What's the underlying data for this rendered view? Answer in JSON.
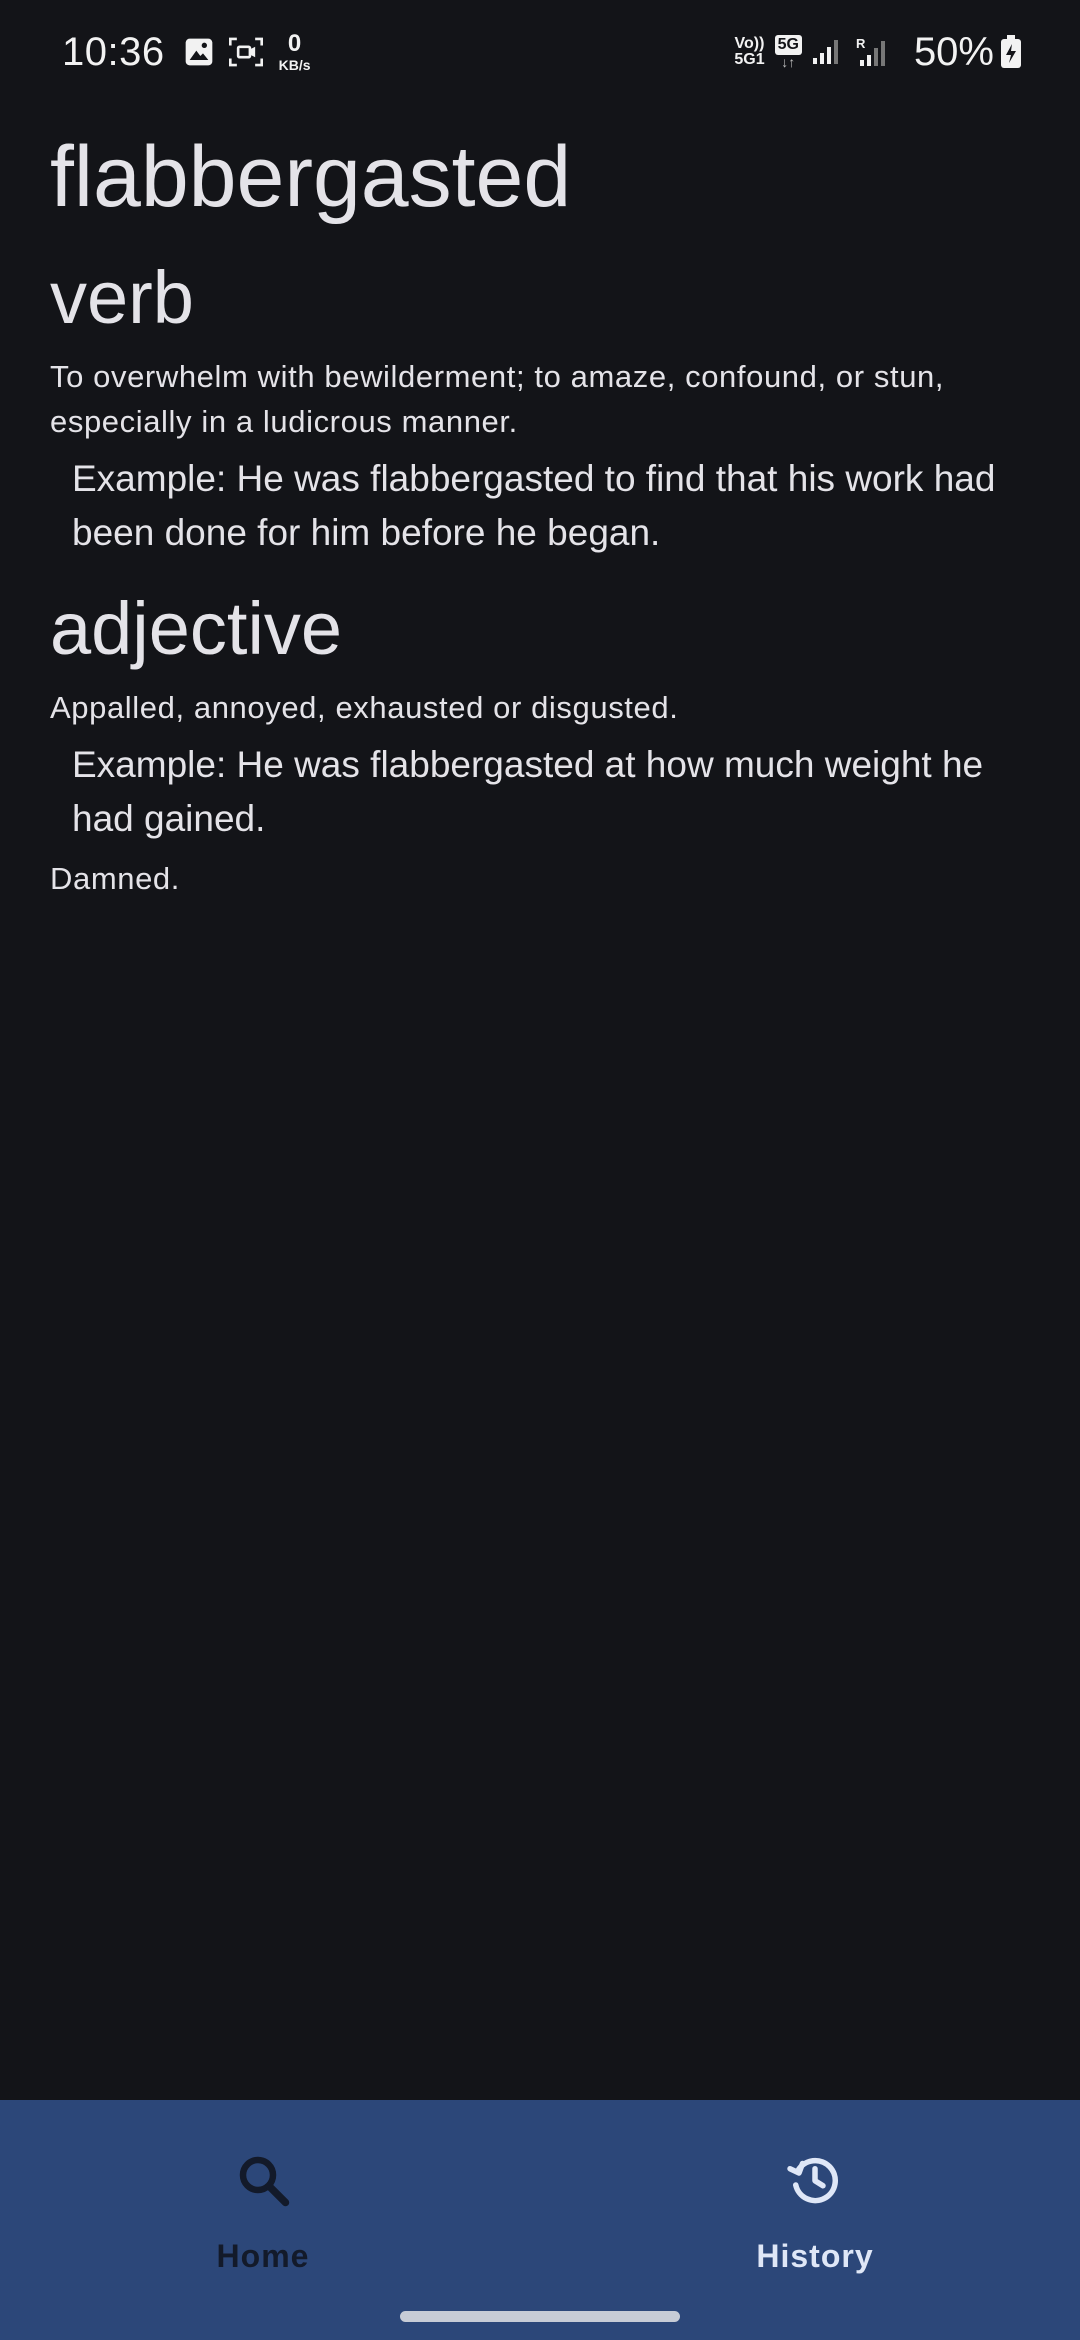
{
  "status_bar": {
    "time": "10:36",
    "net_speed_value": "0",
    "net_speed_unit": "KB/s",
    "volte_top": "Vo))",
    "volte_bottom": "5G1",
    "network_type": "5G",
    "network_arrows": "↓↑",
    "roaming": "R",
    "battery_percent": "50%",
    "icons": [
      "gallery-icon",
      "screen-record-icon",
      "signal-icon",
      "signal-roaming-icon",
      "battery-charging-icon"
    ]
  },
  "entry": {
    "word": "flabbergasted",
    "senses": [
      {
        "part_of_speech": "verb",
        "definition": "To overwhelm with bewilderment; to amaze, confound, or stun, especially in a ludicrous manner.",
        "example": "Example: He was flabbergasted to find that his work had been done for him before he began."
      },
      {
        "part_of_speech": "adjective",
        "definition": "Appalled, annoyed, exhausted or disgusted.",
        "example": "Example: He was flabbergasted at how much weight he had gained.",
        "definition_2": "Damned."
      }
    ]
  },
  "bottom_nav": {
    "items": [
      {
        "label": "Home",
        "icon": "search-icon",
        "selected": false
      },
      {
        "label": "History",
        "icon": "history-icon",
        "selected": true
      }
    ],
    "background_color": "#2c4779"
  },
  "colors": {
    "background": "#131418",
    "text": "#e4e3e8"
  }
}
